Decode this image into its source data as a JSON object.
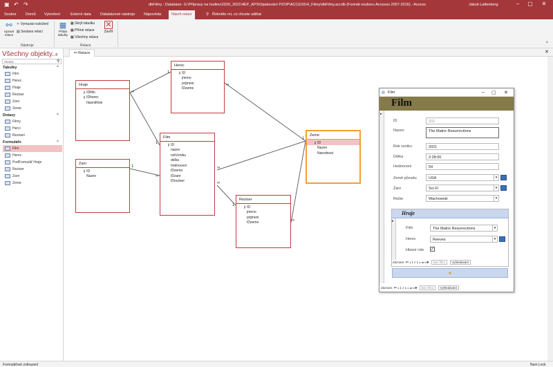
{
  "titlebar": {
    "title": "dbFilmy : Databáze- G:\\Přípravy na hodinu\\2020_2021\\4EP_AP3\\Opakování PZOP\\ACCESS\\4_Filmy\\dbFilmy.accdb (Formát souboru Accessu 2007-2016) - Access",
    "user": "Jakub Lattenberg"
  },
  "menu": {
    "tabs": [
      "Soubor",
      "Domů",
      "Vytvoření",
      "Externí data",
      "Databázové nástroje",
      "Nápověda",
      "Návrh relací"
    ],
    "active_tab": "Návrh relací",
    "search": "Řekněte mi, co chcete udělat"
  },
  "ribbon": {
    "edit_relations": "Upravit relace",
    "clear_layout": "Vymazat rozložení",
    "relation_report": "Sestava relací",
    "tools_group": "Nástroje",
    "add_tables": "Přidat tabulky",
    "hide_table": "Skrýt tabulku",
    "direct_relations": "Přímé relace",
    "all_relations": "Všechny relace",
    "close": "Zavřít",
    "relations_group": "Relace"
  },
  "nav": {
    "title": "Všechny objekty...",
    "search_placeholder": "Hledat...",
    "sections": [
      {
        "label": "Tabulky",
        "items": [
          "Film",
          "Herec",
          "Hraje",
          "Reziser",
          "Zanr",
          "Zeme"
        ]
      },
      {
        "label": "Dotazy",
        "items": [
          "Filmy",
          "Herci",
          "Reziseri"
        ]
      },
      {
        "label": "Formuláře",
        "items": [
          "Film",
          "Herec",
          "PodFormulář Hraje",
          "Reziser",
          "Zanr",
          "Zeme"
        ]
      }
    ],
    "selected": "Film"
  },
  "doc_tab": "Relace",
  "tables": {
    "hraje": {
      "title": "Hraje",
      "fields": [
        "IDfilm",
        "IDherec",
        "hlavniRole"
      ],
      "pk": [
        0,
        1
      ]
    },
    "herec": {
      "title": "Herec",
      "fields": [
        "ID",
        "jmeno",
        "prijmeni",
        "IDzeme"
      ],
      "pk": [
        0
      ]
    },
    "film": {
      "title": "Film",
      "fields": [
        "ID",
        "nazev",
        "rokVzniku",
        "delka",
        "hodnoceni",
        "IDzeme",
        "IDzanr",
        "IDreziser"
      ],
      "pk": [
        0
      ]
    },
    "zanr": {
      "title": "Zanr",
      "fields": [
        "ID",
        "Nazev"
      ],
      "pk": [
        0
      ]
    },
    "zeme": {
      "title": "Zeme",
      "fields": [
        "ID",
        "Nazev",
        "Narodnost"
      ],
      "pk": [
        0
      ]
    },
    "reziser": {
      "title": "Reziser",
      "fields": [
        "ID",
        "jmeno",
        "prijmeni",
        "IDzeme"
      ],
      "pk": [
        0
      ]
    }
  },
  "form": {
    "window_title": "Film",
    "header": "Film",
    "fields": [
      {
        "label": "ID",
        "value": "232"
      },
      {
        "label": "Nazev",
        "value": "The Matrix Resurrections"
      },
      {
        "label": "Rok vzniku",
        "value": "2021"
      },
      {
        "label": "Délka",
        "value": "2:28:00"
      },
      {
        "label": "Hodnoceni",
        "value": "54"
      },
      {
        "label": "Země původu",
        "value": "USA"
      },
      {
        "label": "Žánr",
        "value": "Sci-Fi"
      },
      {
        "label": "Režie",
        "value": "Wachowski"
      }
    ],
    "subform": {
      "header": "Hraje",
      "film_label": "Film",
      "film_value": "The Matrix Resurrections",
      "herec_label": "Herec",
      "herec_value": "Reeves",
      "role_label": "Hlavní role",
      "role_checked": true,
      "nav_record": "Záznam:",
      "nav_pos": "1 z 1",
      "nav_filter": "Bez filtru",
      "nav_search": "Vyhledávání"
    },
    "nav_record": "Záznam:",
    "nav_pos": "1 z 1",
    "nav_filter": "Bez filtru",
    "nav_search": "Vyhledávání"
  },
  "status": {
    "left": "Formulářové zobrazení",
    "right": "Num Lock"
  }
}
